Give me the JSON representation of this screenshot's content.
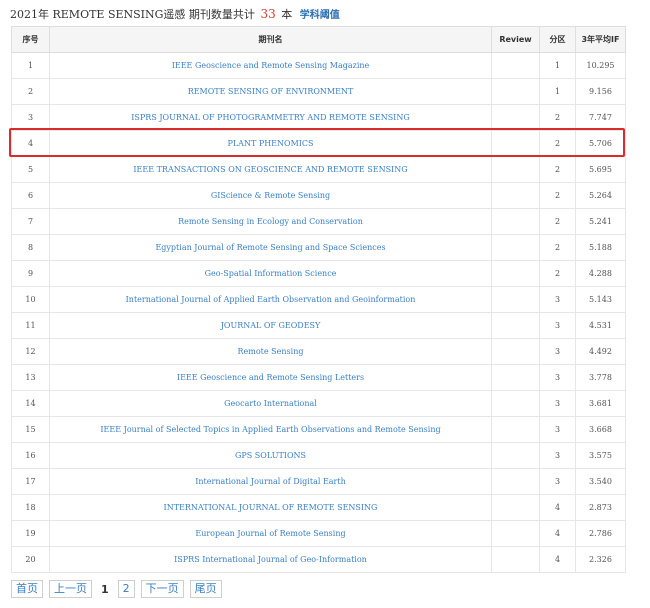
{
  "header": {
    "prefix": "2021年 REMOTE SENSING遥感 期刊数量共计",
    "count": "33",
    "suffix": "本",
    "threshold_link": "学科阈值"
  },
  "table": {
    "columns": [
      "序号",
      "期刊名",
      "Review",
      "分区",
      "3年平均IF"
    ],
    "rows": [
      {
        "no": "1",
        "name": "IEEE Geoscience and Remote Sensing Magazine",
        "review": "",
        "zone": "1",
        "if": "10.295"
      },
      {
        "no": "2",
        "name": "REMOTE SENSING OF ENVIRONMENT",
        "review": "",
        "zone": "1",
        "if": "9.156"
      },
      {
        "no": "3",
        "name": "ISPRS JOURNAL OF PHOTOGRAMMETRY AND REMOTE SENSING",
        "review": "",
        "zone": "2",
        "if": "7.747"
      },
      {
        "no": "4",
        "name": "PLANT PHENOMICS",
        "review": "",
        "zone": "2",
        "if": "5.706"
      },
      {
        "no": "5",
        "name": "IEEE TRANSACTIONS ON GEOSCIENCE AND REMOTE SENSING",
        "review": "",
        "zone": "2",
        "if": "5.695"
      },
      {
        "no": "6",
        "name": "GIScience & Remote Sensing",
        "review": "",
        "zone": "2",
        "if": "5.264"
      },
      {
        "no": "7",
        "name": "Remote Sensing in Ecology and Conservation",
        "review": "",
        "zone": "2",
        "if": "5.241"
      },
      {
        "no": "8",
        "name": "Egyptian Journal of Remote Sensing and Space Sciences",
        "review": "",
        "zone": "2",
        "if": "5.188"
      },
      {
        "no": "9",
        "name": "Geo-Spatial Information Science",
        "review": "",
        "zone": "2",
        "if": "4.288"
      },
      {
        "no": "10",
        "name": "International Journal of Applied Earth Observation and Geoinformation",
        "review": "",
        "zone": "3",
        "if": "5.143"
      },
      {
        "no": "11",
        "name": "JOURNAL OF GEODESY",
        "review": "",
        "zone": "3",
        "if": "4.531"
      },
      {
        "no": "12",
        "name": "Remote Sensing",
        "review": "",
        "zone": "3",
        "if": "4.492"
      },
      {
        "no": "13",
        "name": "IEEE Geoscience and Remote Sensing Letters",
        "review": "",
        "zone": "3",
        "if": "3.778"
      },
      {
        "no": "14",
        "name": "Geocarto International",
        "review": "",
        "zone": "3",
        "if": "3.681"
      },
      {
        "no": "15",
        "name": "IEEE Journal of Selected Topics in Applied Earth Observations and Remote Sensing",
        "review": "",
        "zone": "3",
        "if": "3.668"
      },
      {
        "no": "16",
        "name": "GPS SOLUTIONS",
        "review": "",
        "zone": "3",
        "if": "3.575"
      },
      {
        "no": "17",
        "name": "International Journal of Digital Earth",
        "review": "",
        "zone": "3",
        "if": "3.540"
      },
      {
        "no": "18",
        "name": "INTERNATIONAL JOURNAL OF REMOTE SENSING",
        "review": "",
        "zone": "4",
        "if": "2.873"
      },
      {
        "no": "19",
        "name": "European Journal of Remote Sensing",
        "review": "",
        "zone": "4",
        "if": "2.786"
      },
      {
        "no": "20",
        "name": "ISPRS International Journal of Geo-Information",
        "review": "",
        "zone": "4",
        "if": "2.326"
      }
    ]
  },
  "pagination": {
    "first": "首页",
    "prev": "上一页",
    "current": "1",
    "page2": "2",
    "next": "下一页",
    "last": "尾页"
  },
  "colors": {
    "highlight_border": "#d92c2c",
    "count_color": "#e03c31",
    "link_color": "#3a7fc4"
  }
}
